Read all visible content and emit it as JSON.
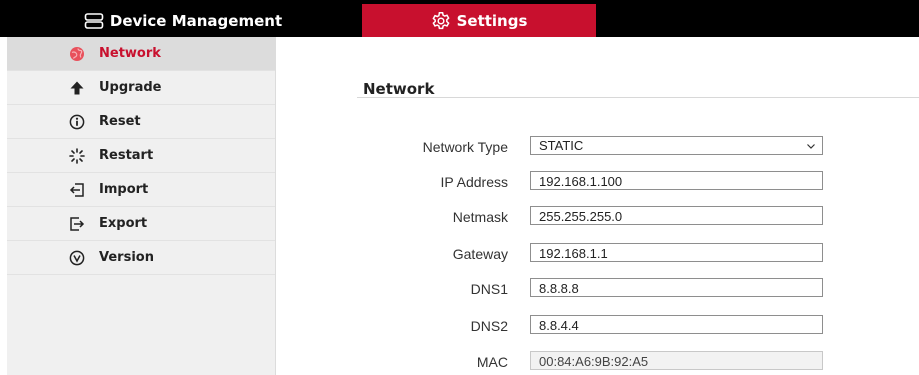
{
  "topnav": {
    "device_management": {
      "label": "Device Management",
      "icon": "server-icon"
    },
    "settings": {
      "label": "Settings",
      "icon": "gear-icon",
      "active": true
    }
  },
  "colors": {
    "accent": "#c8102e",
    "topbar": "#000000",
    "sidebar": "#f0f0f0",
    "active_item": "#dcdcdc"
  },
  "sidebar": {
    "items": [
      {
        "label": "Network",
        "icon": "network-globe-icon",
        "active": true
      },
      {
        "label": "Upgrade",
        "icon": "arrow-up-icon"
      },
      {
        "label": "Reset",
        "icon": "info-circle-icon"
      },
      {
        "label": "Restart",
        "icon": "loading-spinner-icon"
      },
      {
        "label": "Import",
        "icon": "import-icon"
      },
      {
        "label": "Export",
        "icon": "export-icon"
      },
      {
        "label": "Version",
        "icon": "version-circle-icon"
      }
    ]
  },
  "main": {
    "title": "Network",
    "fields": {
      "network_type": {
        "label": "Network Type",
        "value": "STATIC"
      },
      "ip_address": {
        "label": "IP Address",
        "value": "192.168.1.100"
      },
      "netmask": {
        "label": "Netmask",
        "value": "255.255.255.0"
      },
      "gateway": {
        "label": "Gateway",
        "value": "192.168.1.1"
      },
      "dns1": {
        "label": "DNS1",
        "value": "8.8.8.8"
      },
      "dns2": {
        "label": "DNS2",
        "value": "8.8.4.4"
      },
      "mac": {
        "label": "MAC",
        "value": "00:84:A6:9B:92:A5"
      }
    }
  }
}
